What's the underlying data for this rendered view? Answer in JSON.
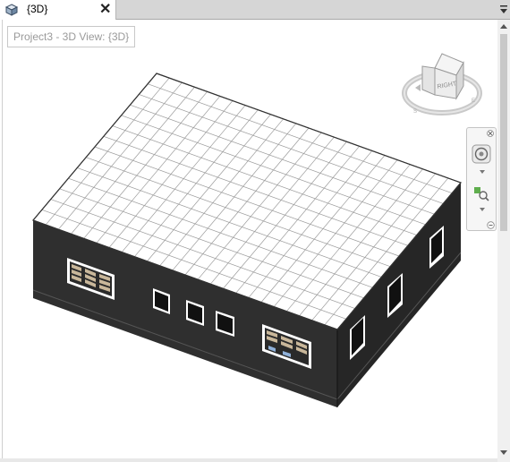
{
  "tab": {
    "title": "{3D}",
    "close_glyph": "✕",
    "icon": "3d-view-cube-icon"
  },
  "view": {
    "title_box": "Project3 - 3D View: {3D}"
  },
  "viewcube": {
    "face_label": "RIGHT",
    "icons": [
      "viewcube-icon",
      "compass-ring-icon",
      "home-icon"
    ]
  },
  "navbar": {
    "icons": [
      "close-icon",
      "steering-wheel-icon",
      "chevron-down-icon",
      "zoom-region-icon",
      "chevron-down-icon",
      "resize-grip-icon"
    ]
  },
  "scrollbar": {
    "icons": [
      "scroll-up-arrow-icon",
      "scroll-down-arrow-icon"
    ]
  },
  "colors": {
    "wall": "#2e2e2e",
    "wall_side": "#262626",
    "roof": "#ffffff",
    "grid_line": "#9a9a9a",
    "window_frame": "#ffffff",
    "window_glass": "#c9b79a"
  }
}
